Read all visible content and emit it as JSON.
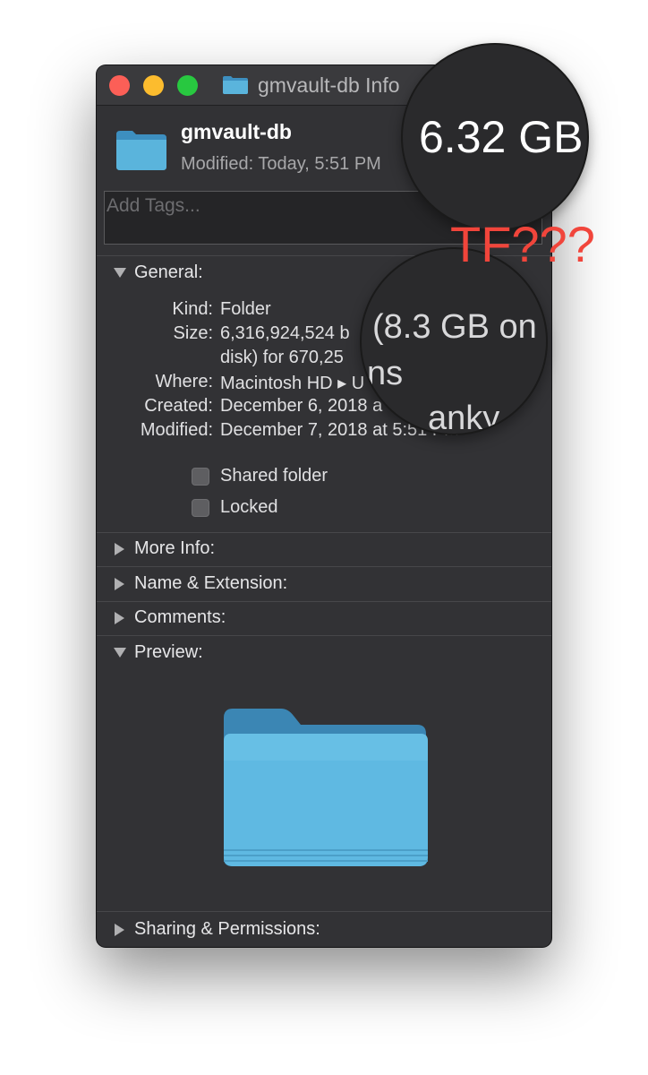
{
  "window": {
    "title": "gmvault-db Info"
  },
  "header": {
    "file_name": "gmvault-db",
    "modified_label": "Modified:",
    "modified_value": "Today, 5:51 PM"
  },
  "tags": {
    "placeholder": "Add Tags..."
  },
  "general": {
    "label": "General:",
    "rows": [
      {
        "key": "Kind:",
        "value": "Folder"
      },
      {
        "key": "Size:",
        "value": "6,316,924,524 b"
      },
      {
        "key": "",
        "value": "disk) for 670,25"
      },
      {
        "key": "Where:",
        "value": "Macintosh HD ▸ U"
      },
      {
        "key": "Created:",
        "value": "December 6, 2018 a"
      },
      {
        "key": "Modified:",
        "value": "December 7, 2018 at 5:51 PM"
      }
    ],
    "shared_folder": {
      "label": "Shared folder",
      "checked": false
    },
    "locked": {
      "label": "Locked",
      "checked": false
    }
  },
  "sections": {
    "more_info": "More Info:",
    "name_extension": "Name & Extension:",
    "comments": "Comments:",
    "preview": "Preview:",
    "sharing": "Sharing & Permissions:"
  },
  "magnifier": {
    "size_gb": "6.32 GB",
    "on_disk_line": "(8.3 GB on",
    "fragment_2": "ns",
    "fragment_3": "anky"
  },
  "annotation": "TF???",
  "colors": {
    "window_bg": "#323235",
    "folder_blue": "#5ab4dc",
    "annotation_red": "#f1453b",
    "close": "#fc5f57",
    "minimize": "#fcbc2e",
    "zoom": "#28c840"
  },
  "icons": [
    "folder-icon",
    "disclosure-triangle-icon"
  ]
}
